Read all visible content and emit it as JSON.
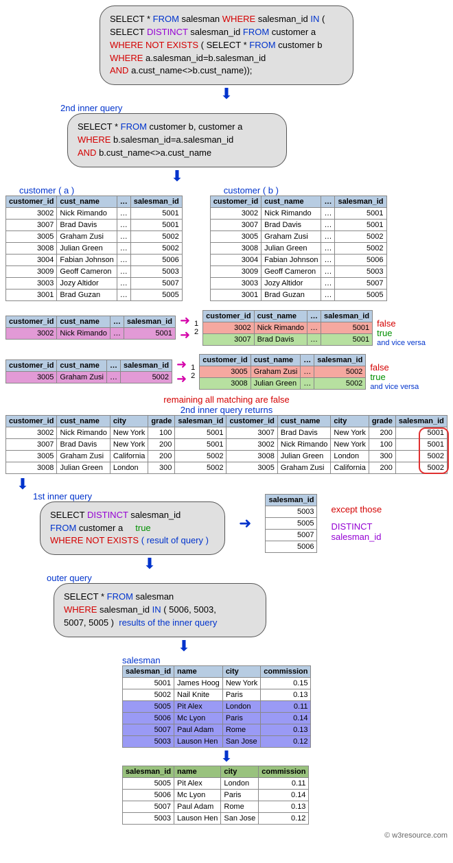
{
  "outer_bubble": {
    "l1a": "SELECT * ",
    "l1b": "FROM",
    "l1c": " salesman ",
    "l1d": "WHERE",
    "l1e": " salesman_id ",
    "l1f": "IN",
    "l1g": " (",
    "l2a": "SELECT ",
    "l2b": "DISTINCT",
    "l2c": " salesman_id ",
    "l2d": "FROM",
    "l2e": " customer a",
    "l3a": "WHERE NOT EXISTS",
    "l3b": " ( SELECT * ",
    "l3c": "FROM",
    "l3d": " customer b",
    "l4a": "WHERE",
    "l4b": " a.salesman_id=b.salesman_id",
    "l5a": "AND",
    "l5b": " a.cust_name<>b.cust_name));"
  },
  "labels": {
    "second_inner": "2nd inner query",
    "first_inner": "1st inner query",
    "outer_query": "outer query",
    "customer_a": "customer ( a )",
    "customer_b": "customer ( b )",
    "remaining_false": "remaining all matching are false",
    "second_returns": "2nd inner query returns",
    "except_those": "except those",
    "distinct_sid": "DISTINCT",
    "distinct_sid2": "salesman_id",
    "true": "true",
    "result_of_query": "( result of query )",
    "results_inner": "results of the inner query",
    "false": "false",
    "vice_versa": "and vice versa",
    "salesman_label": "salesman"
  },
  "second_bubble": {
    "l1a": "SELECT * ",
    "l1b": "FROM",
    "l1c": " customer b, customer a",
    "l2a": "WHERE",
    "l2b": " b.salesman_id=a.salesman_id",
    "l3a": "AND",
    "l3b": " b.cust_name<>a.cust_name"
  },
  "first_inner_bubble": {
    "l1a": "SELECT ",
    "l1b": "DISTINCT",
    "l1c": " salesman_id",
    "l2a": "FROM",
    "l2b": " customer a",
    "l3a": "WHERE NOT EXISTS"
  },
  "outer_bubble2": {
    "l1a": "SELECT * ",
    "l1b": "FROM",
    "l1c": " salesman",
    "l2a": "WHERE",
    "l2b": " salesman_id ",
    "l2c": "IN",
    "l2d": " ( 5006, 5003,",
    "l3a": "5007, 5005 )"
  },
  "cust_headers": [
    "customer_id",
    "cust_name",
    "…",
    "salesman_id"
  ],
  "cust_rows": [
    {
      "id": "3002",
      "name": "Nick Rimando",
      "sid": "5001"
    },
    {
      "id": "3007",
      "name": "Brad Davis",
      "sid": "5001"
    },
    {
      "id": "3005",
      "name": "Graham Zusi",
      "sid": "5002"
    },
    {
      "id": "3008",
      "name": "Julian Green",
      "sid": "5002"
    },
    {
      "id": "3004",
      "name": "Fabian Johnson",
      "sid": "5006"
    },
    {
      "id": "3009",
      "name": "Geoff Cameron",
      "sid": "5003"
    },
    {
      "id": "3003",
      "name": "Jozy Altidor",
      "sid": "5007"
    },
    {
      "id": "3001",
      "name": "Brad Guzan",
      "sid": "5005"
    }
  ],
  "mini_a1": {
    "id": "3002",
    "name": "Nick Rimando",
    "sid": "5001"
  },
  "mini_b1": [
    {
      "id": "3002",
      "name": "Nick Rimando",
      "sid": "5001",
      "tag": "false",
      "cls": "row-redish"
    },
    {
      "id": "3007",
      "name": "Brad Davis",
      "sid": "5001",
      "tag": "true",
      "cls": "row-greenish"
    }
  ],
  "mini_a2": {
    "id": "3005",
    "name": "Graham Zusi",
    "sid": "5002"
  },
  "mini_b2": [
    {
      "id": "3005",
      "name": "Graham Zusi",
      "sid": "5002",
      "tag": "false",
      "cls": "row-redish"
    },
    {
      "id": "3008",
      "name": "Julian Green",
      "sid": "5002",
      "tag": "true",
      "cls": "row-greenish"
    }
  ],
  "wide_headers": [
    "customer_id",
    "cust_name",
    "city",
    "grade",
    "salesman_id",
    "customer_id",
    "cust_name",
    "city",
    "grade",
    "salesman_id"
  ],
  "wide_rows": [
    [
      "3002",
      "Nick Rimando",
      "New York",
      "100",
      "5001",
      "3007",
      "Brad Davis",
      "New York",
      "200",
      "5001"
    ],
    [
      "3007",
      "Brad Davis",
      "New York",
      "200",
      "5001",
      "3002",
      "Nick Rimando",
      "New York",
      "100",
      "5001"
    ],
    [
      "3005",
      "Graham Zusi",
      "California",
      "200",
      "5002",
      "3008",
      "Julian Green",
      "London",
      "300",
      "5002"
    ],
    [
      "3008",
      "Julian Green",
      "London",
      "300",
      "5002",
      "3005",
      "Graham Zusi",
      "California",
      "200",
      "5002"
    ]
  ],
  "distinct_sid_header": "salesman_id",
  "distinct_sid_rows": [
    "5003",
    "5005",
    "5007",
    "5006"
  ],
  "salesman_headers": [
    "salesman_id",
    "name",
    "city",
    "commission"
  ],
  "salesman_rows": [
    {
      "id": "5001",
      "name": "James Hoog",
      "city": "New York",
      "comm": "0.15",
      "hl": false
    },
    {
      "id": "5002",
      "name": "Nail Knite",
      "city": "Paris",
      "comm": "0.13",
      "hl": false
    },
    {
      "id": "5005",
      "name": "Pit Alex",
      "city": "London",
      "comm": "0.11",
      "hl": true
    },
    {
      "id": "5006",
      "name": "Mc Lyon",
      "city": "Paris",
      "comm": "0.14",
      "hl": true
    },
    {
      "id": "5007",
      "name": "Paul Adam",
      "city": "Rome",
      "comm": "0.13",
      "hl": true
    },
    {
      "id": "5003",
      "name": "Lauson Hen",
      "city": "San Jose",
      "comm": "0.12",
      "hl": true
    }
  ],
  "final_rows": [
    {
      "id": "5005",
      "name": "Pit Alex",
      "city": "London",
      "comm": "0.11"
    },
    {
      "id": "5006",
      "name": "Mc Lyon",
      "city": "Paris",
      "comm": "0.14"
    },
    {
      "id": "5007",
      "name": "Paul Adam",
      "city": "Rome",
      "comm": "0.13"
    },
    {
      "id": "5003",
      "name": "Lauson Hen",
      "city": "San Jose",
      "comm": "0.12"
    }
  ],
  "arrow_nums": {
    "one": "1",
    "two": "2"
  },
  "footer": "© w3resource.com",
  "chart_data": {
    "type": "table",
    "title": "SQL subquery visual explanation of salesmen with exactly one customer",
    "customer": [
      {
        "customer_id": 3002,
        "cust_name": "Nick Rimando",
        "salesman_id": 5001
      },
      {
        "customer_id": 3007,
        "cust_name": "Brad Davis",
        "salesman_id": 5001
      },
      {
        "customer_id": 3005,
        "cust_name": "Graham Zusi",
        "salesman_id": 5002
      },
      {
        "customer_id": 3008,
        "cust_name": "Julian Green",
        "salesman_id": 5002
      },
      {
        "customer_id": 3004,
        "cust_name": "Fabian Johnson",
        "salesman_id": 5006
      },
      {
        "customer_id": 3009,
        "cust_name": "Geoff Cameron",
        "salesman_id": 5003
      },
      {
        "customer_id": 3003,
        "cust_name": "Jozy Altidor",
        "salesman_id": 5007
      },
      {
        "customer_id": 3001,
        "cust_name": "Brad Guzan",
        "salesman_id": 5005
      }
    ],
    "second_inner_query_result": [
      {
        "customer_id": 3002,
        "cust_name": "Nick Rimando",
        "city": "New York",
        "grade": 100,
        "salesman_id": 5001,
        "b_customer_id": 3007,
        "b_cust_name": "Brad Davis",
        "b_city": "New York",
        "b_grade": 200,
        "b_salesman_id": 5001
      },
      {
        "customer_id": 3007,
        "cust_name": "Brad Davis",
        "city": "New York",
        "grade": 200,
        "salesman_id": 5001,
        "b_customer_id": 3002,
        "b_cust_name": "Nick Rimando",
        "b_city": "New York",
        "b_grade": 100,
        "b_salesman_id": 5001
      },
      {
        "customer_id": 3005,
        "cust_name": "Graham Zusi",
        "city": "California",
        "grade": 200,
        "salesman_id": 5002,
        "b_customer_id": 3008,
        "b_cust_name": "Julian Green",
        "b_city": "London",
        "b_grade": 300,
        "b_salesman_id": 5002
      },
      {
        "customer_id": 3008,
        "cust_name": "Julian Green",
        "city": "London",
        "grade": 300,
        "salesman_id": 5002,
        "b_customer_id": 3005,
        "b_cust_name": "Graham Zusi",
        "b_city": "California",
        "b_grade": 200,
        "b_salesman_id": 5002
      }
    ],
    "distinct_salesman_id_not_exists": [
      5003,
      5005,
      5007,
      5006
    ],
    "salesman": [
      {
        "salesman_id": 5001,
        "name": "James Hoog",
        "city": "New York",
        "commission": 0.15
      },
      {
        "salesman_id": 5002,
        "name": "Nail Knite",
        "city": "Paris",
        "commission": 0.13
      },
      {
        "salesman_id": 5005,
        "name": "Pit Alex",
        "city": "London",
        "commission": 0.11
      },
      {
        "salesman_id": 5006,
        "name": "Mc Lyon",
        "city": "Paris",
        "commission": 0.14
      },
      {
        "salesman_id": 5007,
        "name": "Paul Adam",
        "city": "Rome",
        "commission": 0.13
      },
      {
        "salesman_id": 5003,
        "name": "Lauson Hen",
        "city": "San Jose",
        "commission": 0.12
      }
    ],
    "final_result": [
      {
        "salesman_id": 5005,
        "name": "Pit Alex",
        "city": "London",
        "commission": 0.11
      },
      {
        "salesman_id": 5006,
        "name": "Mc Lyon",
        "city": "Paris",
        "commission": 0.14
      },
      {
        "salesman_id": 5007,
        "name": "Paul Adam",
        "city": "Rome",
        "commission": 0.13
      },
      {
        "salesman_id": 5003,
        "name": "Lauson Hen",
        "city": "San Jose",
        "commission": 0.12
      }
    ]
  }
}
